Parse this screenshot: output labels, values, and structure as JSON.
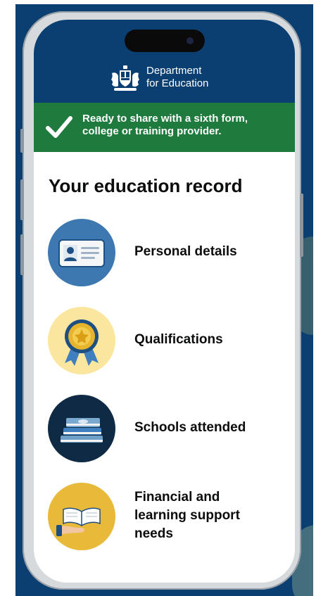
{
  "header": {
    "department_line1": "Department",
    "department_line2": "for Education",
    "crest_icon": "royal-coat-of-arms-icon"
  },
  "banner": {
    "message_line1": "Ready to share with a sixth form,",
    "message_line2": "college or training provider.",
    "icon": "checkmark-icon",
    "color": "#1f7a3d"
  },
  "main": {
    "title": "Your education record",
    "items": [
      {
        "label": "Personal details",
        "icon": "id-card-icon"
      },
      {
        "label": "Qualifications",
        "icon": "rosette-medal-icon"
      },
      {
        "label": "Schools attended",
        "icon": "book-stack-icon"
      },
      {
        "label": "Financial and learning support needs",
        "icon": "hand-holding-book-icon"
      }
    ]
  },
  "colors": {
    "brand_blue": "#0b3f72",
    "success_green": "#1f7a3d",
    "text": "#0b0c0c"
  }
}
